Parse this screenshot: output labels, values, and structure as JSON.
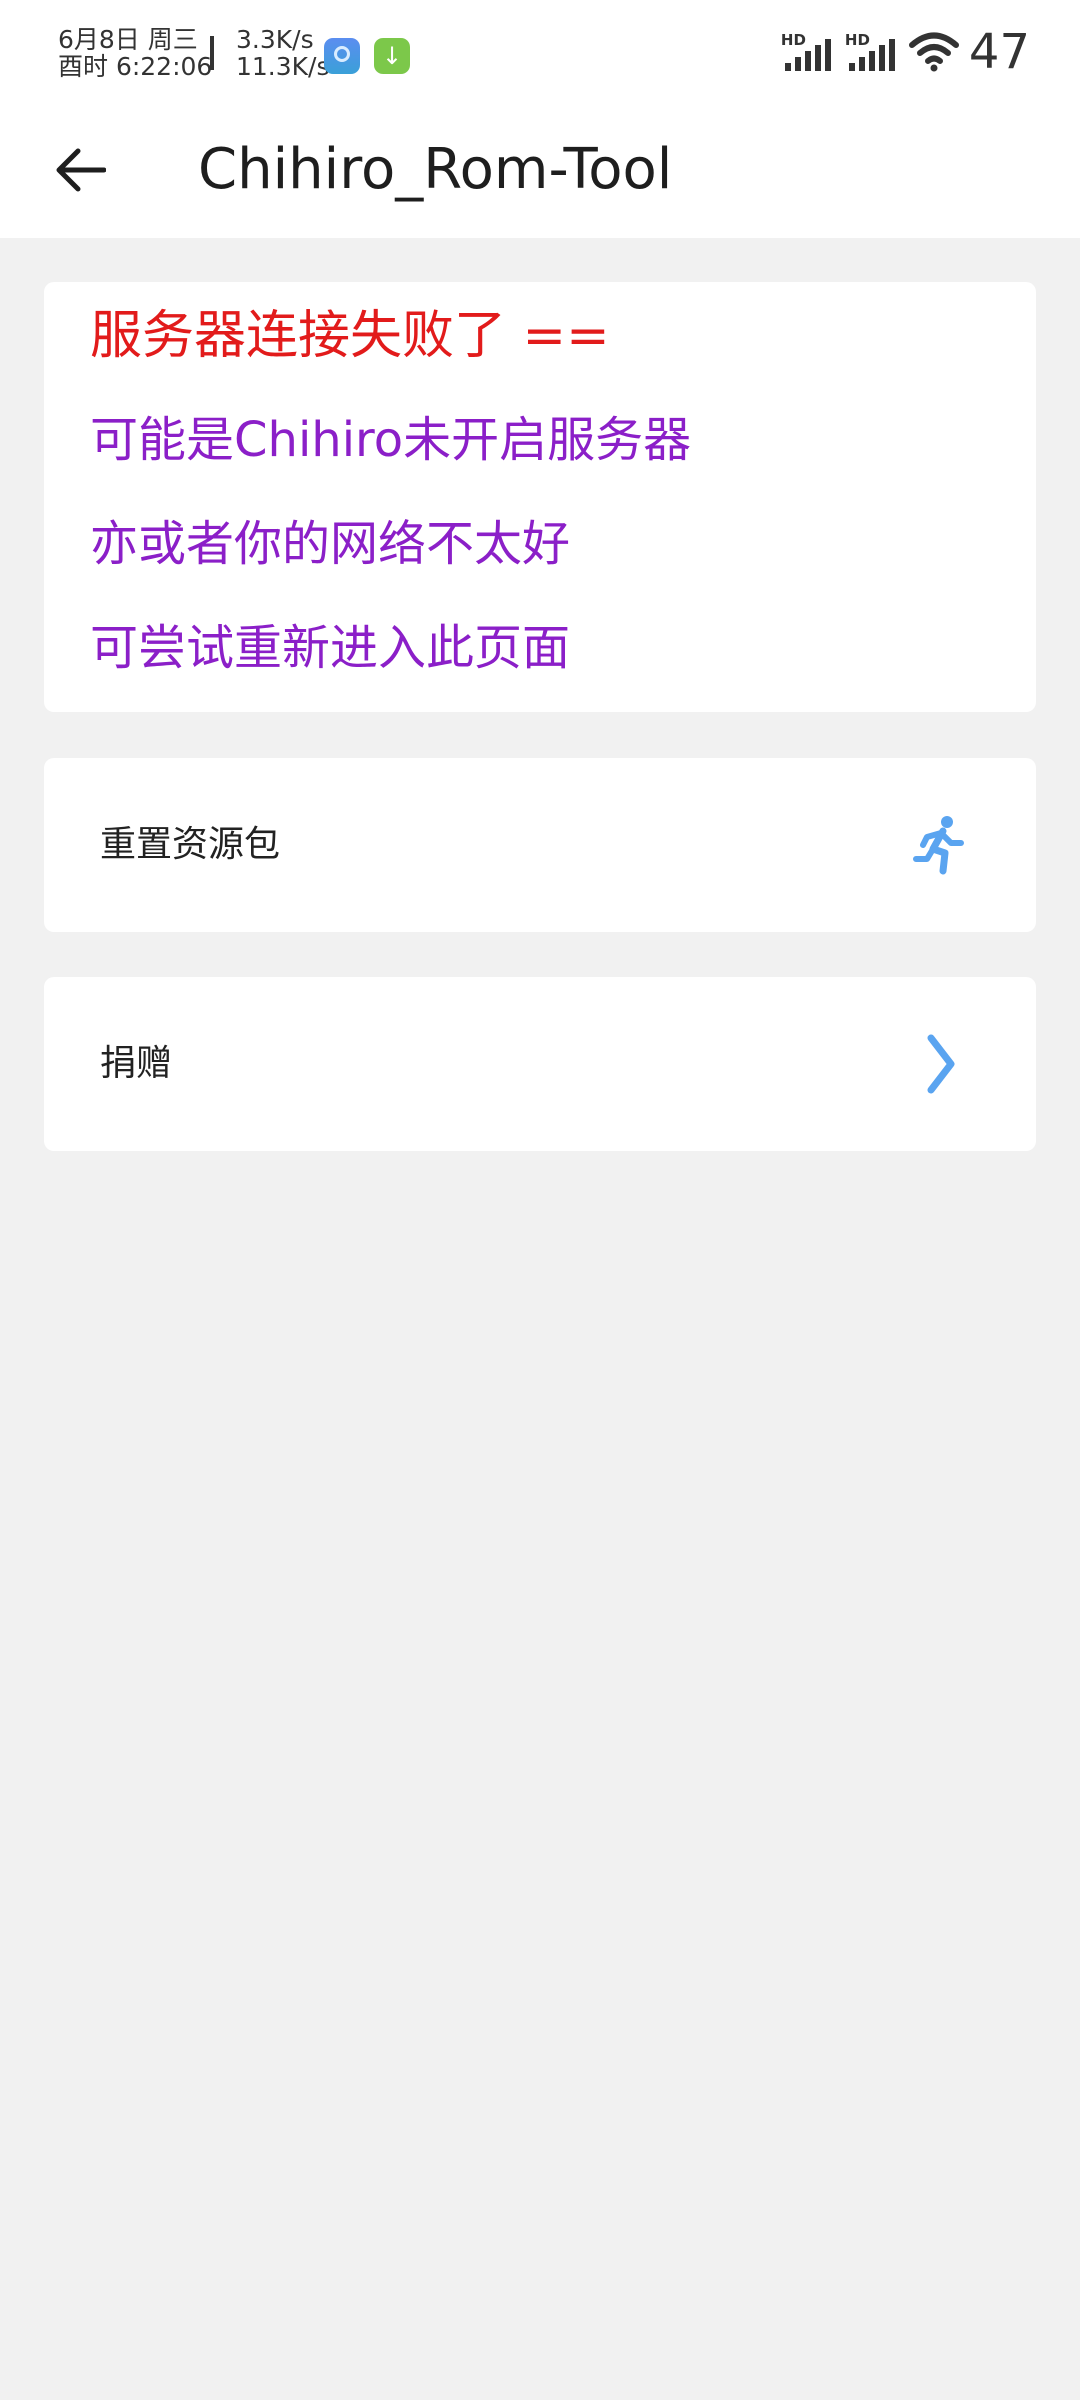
{
  "status_bar": {
    "date": "6月8日 周三",
    "time": "酉时 6:22:06",
    "upload_speed": "3.3K/s",
    "download_speed": "11.3K/s",
    "hd_label": "HD",
    "battery": "47"
  },
  "app_bar": {
    "back_icon": "arrow-left-icon",
    "title": "Chihiro_Rom-Tool"
  },
  "message": {
    "error": "服务器连接失败了 ==",
    "lines": [
      "可能是Chihiro未开启服务器",
      "亦或者你的网络不太好",
      "可尝试重新进入此页面"
    ],
    "colors": {
      "error": "#e21b1b",
      "info": "#8b1fc8"
    }
  },
  "actions": [
    {
      "label": "重置资源包",
      "icon": "running-person-icon"
    },
    {
      "label": "捐赠",
      "icon": "chevron-right-icon"
    }
  ],
  "accent_color": "#5aa4f0",
  "background_color": "#f1f1f1"
}
